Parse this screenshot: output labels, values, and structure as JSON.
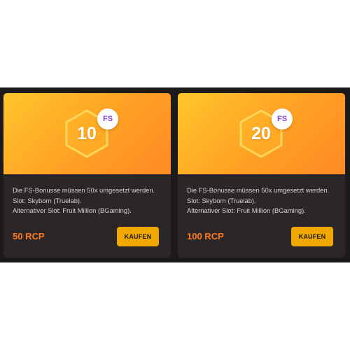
{
  "cards": [
    {
      "amount": "10",
      "badge": "FS",
      "lines": [
        "Die FS-Bonusse müssen 50x umgesetzt werden.",
        "Slot: Skyborn (Truelab).",
        "Alternativer Slot: Fruit Million (BGaming)."
      ],
      "price": "50 RCP",
      "button": "KAUFEN"
    },
    {
      "amount": "20",
      "badge": "FS",
      "lines": [
        "Die FS-Bonusse müssen 50x umgesetzt werden.",
        "Slot: Skyborn (Truelab).",
        "Alternativer Slot: Fruit Million (BGaming)."
      ],
      "price": "100 RCP",
      "button": "KAUFEN"
    }
  ],
  "colors": {
    "card_bg": "#2b2728",
    "gradient_start": "#ffc62c",
    "gradient_end": "#ff8a24",
    "price": "#ff7a1c",
    "button": "#f0a800",
    "badge_text": "#8a3fe0"
  },
  "icons": {
    "hexagon": "hexagon-icon",
    "fs_badge": "fs-badge-icon"
  }
}
